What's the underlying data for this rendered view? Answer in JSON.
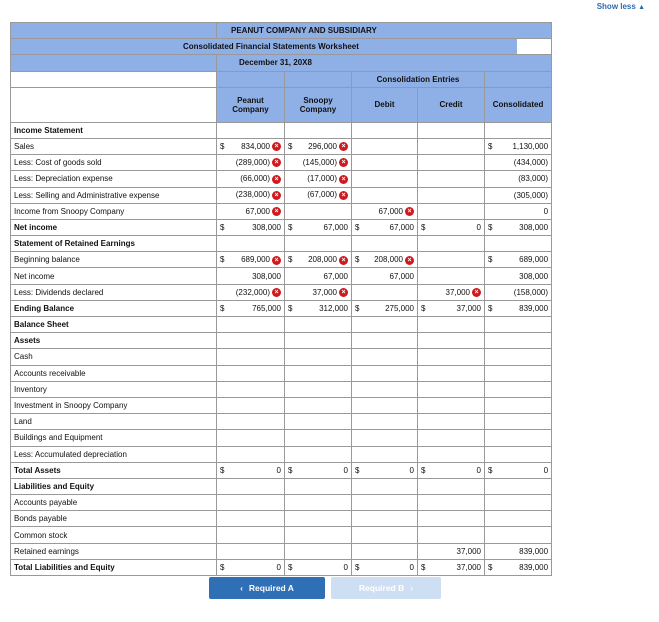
{
  "toggle": {
    "label": "Show less",
    "arrow": "▲"
  },
  "header": {
    "company": "PEANUT COMPANY AND SUBSIDIARY",
    "title": "Consolidated Financial Statements Worksheet",
    "date": "December 31, 20X8"
  },
  "columns": {
    "peanut": "Peanut Company",
    "snoopy": "Snoopy Company",
    "entries": "Consolidation Entries",
    "debit": "Debit",
    "credit": "Credit",
    "consolidated": "Consolidated"
  },
  "rows": [
    {
      "label": "Income Statement",
      "bold": true,
      "section": true
    },
    {
      "label": "Sales",
      "p": "834,000",
      "pD": true,
      "pX": true,
      "s": "296,000",
      "sD": true,
      "sX": true,
      "c": "1,130,000",
      "cD": true
    },
    {
      "label": "Less: Cost of goods sold",
      "p": "(289,000)",
      "pX": true,
      "s": "(145,000)",
      "sX": true,
      "c": "(434,000)"
    },
    {
      "label": "Less: Depreciation expense",
      "p": "(66,000)",
      "pX": true,
      "s": "(17,000)",
      "sX": true,
      "c": "(83,000)"
    },
    {
      "label": "Less: Selling and Administrative expense",
      "p": "(238,000)",
      "pX": true,
      "s": "(67,000)",
      "sX": true,
      "c": "(305,000)"
    },
    {
      "label": "Income from Snoopy Company",
      "p": "67,000",
      "pX": true,
      "d": "67,000",
      "dX": true,
      "c": "0"
    },
    {
      "label": "Net income",
      "bold": true,
      "p": "308,000",
      "pD": true,
      "s": "67,000",
      "sD": true,
      "d": "67,000",
      "dD": true,
      "cr": "0",
      "crD": true,
      "c": "308,000",
      "cD": true
    },
    {
      "label": "Statement of Retained Earnings",
      "bold": true,
      "section": true
    },
    {
      "label": "Beginning balance",
      "p": "689,000",
      "pD": true,
      "pX": true,
      "s": "208,000",
      "sD": true,
      "sX": true,
      "d": "208,000",
      "dD": true,
      "dX": true,
      "c": "689,000",
      "cD": true
    },
    {
      "label": "Net income",
      "p": "308,000",
      "s": "67,000",
      "d": "67,000",
      "c": "308,000"
    },
    {
      "label": "Less: Dividends declared",
      "p": "(232,000)",
      "pX": true,
      "s": "37,000",
      "sX": true,
      "cr": "37,000",
      "crX": true,
      "c": "(158,000)"
    },
    {
      "label": "Ending Balance",
      "bold": true,
      "p": "765,000",
      "pD": true,
      "s": "312,000",
      "sD": true,
      "d": "275,000",
      "dD": true,
      "cr": "37,000",
      "crD": true,
      "c": "839,000",
      "cD": true
    },
    {
      "label": "Balance Sheet",
      "bold": true,
      "section": true
    },
    {
      "label": "Assets",
      "bold": true,
      "section": true
    },
    {
      "label": "Cash"
    },
    {
      "label": "Accounts receivable"
    },
    {
      "label": "Inventory"
    },
    {
      "label": "Investment in Snoopy Company"
    },
    {
      "label": "Land"
    },
    {
      "label": "Buildings and Equipment"
    },
    {
      "label": "Less: Accumulated depreciation"
    },
    {
      "label": "Total Assets",
      "bold": true,
      "p": "0",
      "pD": true,
      "s": "0",
      "sD": true,
      "d": "0",
      "dD": true,
      "cr": "0",
      "crD": true,
      "c": "0",
      "cD": true
    },
    {
      "label": "Liabilities and Equity",
      "bold": true,
      "section": true
    },
    {
      "label": "Accounts payable"
    },
    {
      "label": "Bonds payable"
    },
    {
      "label": "Common stock"
    },
    {
      "label": "Retained earnings",
      "cr": "37,000",
      "c": "839,000"
    },
    {
      "label": "Total Liabilities and Equity",
      "bold": true,
      "p": "0",
      "pD": true,
      "s": "0",
      "sD": true,
      "d": "0",
      "dD": true,
      "cr": "37,000",
      "crD": true,
      "c": "839,000",
      "cD": true
    }
  ],
  "nav": {
    "prev": "Required A",
    "prev_icon": "‹",
    "next": "Required B",
    "next_icon": "›"
  },
  "colors": {
    "header_bg": "#8fb0e6",
    "error_red": "#d0191e",
    "button_blue": "#2f6fb5",
    "button_disabled": "#cfdff3"
  }
}
